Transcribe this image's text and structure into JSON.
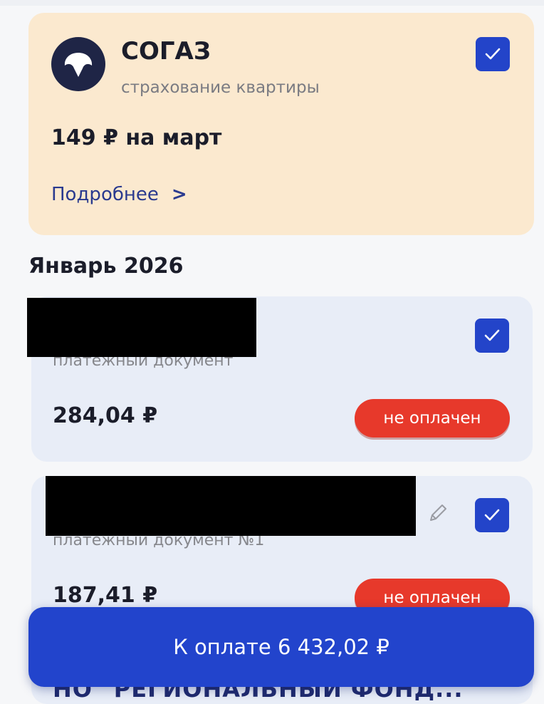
{
  "insurance": {
    "company": "СОГАЗ",
    "subtitle": "страхование квартиры",
    "amount": "149 ₽ на март",
    "more_label": "Подробнее",
    "checked": true
  },
  "section": {
    "title": "Январь 2026"
  },
  "bills": [
    {
      "doc_label": "платежный документ",
      "amount": "284,04 ₽",
      "status": "не оплачен",
      "checked": true
    },
    {
      "doc_label": "платежный документ №1",
      "amount": "187,41 ₽",
      "status": "не оплачен",
      "checked": true
    }
  ],
  "partial_next_title": "НО \"РЕГИОНАЛЬНЫЙ ФОНД...",
  "pay_button": {
    "label": "К оплате 6 432,02 ₽"
  },
  "colors": {
    "accent": "#2244cc",
    "insurance_card": "#fbe9cf",
    "bill_card": "#e8edf7",
    "status_unpaid": "#e7392b"
  }
}
